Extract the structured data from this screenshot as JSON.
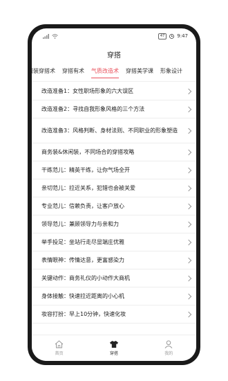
{
  "status": {
    "time": "9:47",
    "battery": "47"
  },
  "header": {
    "title": "穿搭"
  },
  "tabs": [
    {
      "label": "服装穿搭术"
    },
    {
      "label": "穿搭有术"
    },
    {
      "label": "气质改造术"
    },
    {
      "label": "穿搭美学课"
    },
    {
      "label": "形象设计"
    }
  ],
  "active_tab_index": 2,
  "list": [
    {
      "text": "改造准备1：女性职场形象的六大误区"
    },
    {
      "text": "改造准备2：寻找自我形象风格的三个方法"
    },
    {
      "text": "改造准备3：风格判断、身材法则、不同职业的形象塑造"
    },
    {
      "text": "商务装&休闲装，不同场合的穿搭攻略"
    },
    {
      "text": "干练范儿：精英干练，让你气场全开"
    },
    {
      "text": "亲切范儿：拉近关系，犯错也会被关爱"
    },
    {
      "text": "专业范儿：信赖负责，让客户放心"
    },
    {
      "text": "领导范儿：兼顾领导力与亲和力"
    },
    {
      "text": "举手投足：坐站行走尽显端庄优雅"
    },
    {
      "text": "表情眼神：传情达意，更富感染力"
    },
    {
      "text": "关键动作：商务礼仪的小动作大商机"
    },
    {
      "text": "身体接触：快速拉近距离的小心机"
    },
    {
      "text": "妆容打扮：早上10分钟，快速化妆"
    }
  ],
  "tabbar": [
    {
      "label": "首页",
      "icon": "home-icon"
    },
    {
      "label": "穿搭",
      "icon": "shirt-icon"
    },
    {
      "label": "我的",
      "icon": "user-icon"
    }
  ],
  "colors": {
    "accent": "#e8505b",
    "frame": "#1a1a1a"
  }
}
